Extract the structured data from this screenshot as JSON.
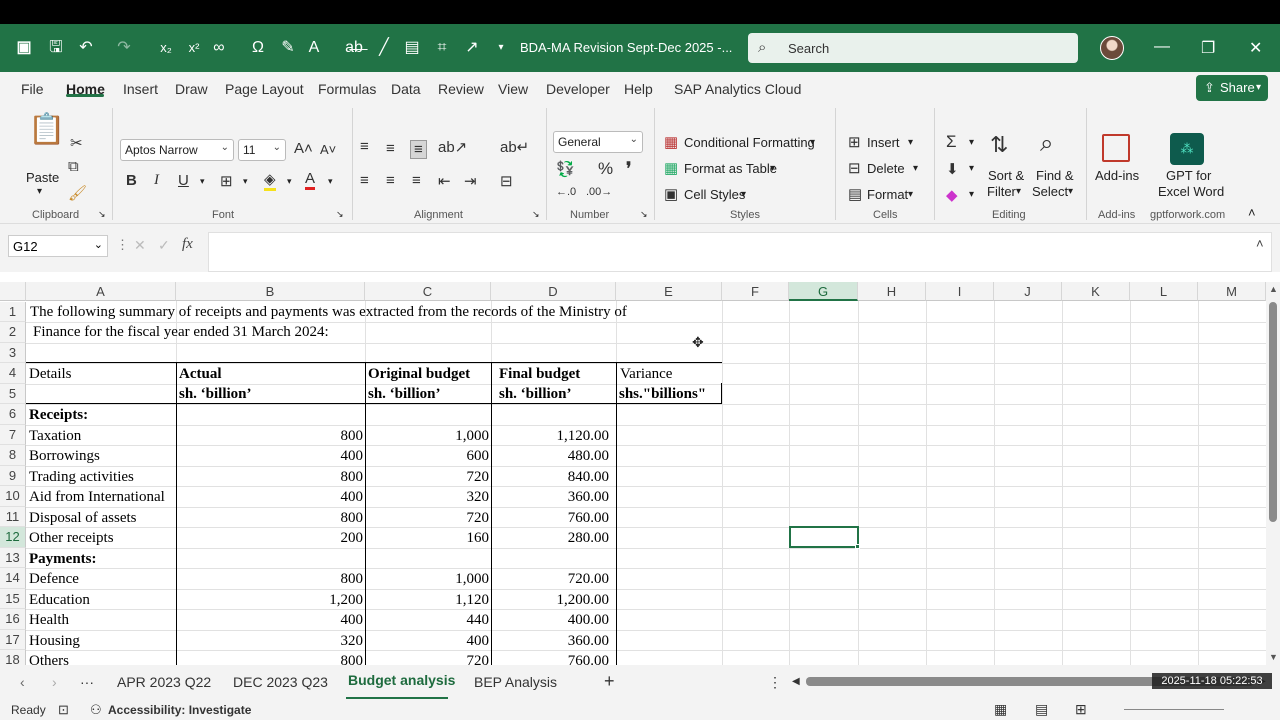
{
  "title_bar": {
    "doc_title": "BDA-MA Revision Sept-Dec 2025  -...",
    "search_placeholder": "Search"
  },
  "menu": {
    "tabs": [
      "File",
      "Home",
      "Insert",
      "Draw",
      "Page Layout",
      "Formulas",
      "Data",
      "Review",
      "View",
      "Developer",
      "Help",
      "SAP Analytics Cloud"
    ],
    "active": "Home",
    "share_label": "Share"
  },
  "ribbon": {
    "clipboard": {
      "paste": "Paste",
      "label": "Clipboard"
    },
    "font": {
      "name": "Aptos Narrow",
      "size": "11",
      "label": "Font"
    },
    "alignment": {
      "label": "Alignment"
    },
    "number": {
      "format": "General",
      "label": "Number"
    },
    "styles": {
      "conditional": "Conditional Formatting",
      "format_table": "Format as Table",
      "cell_styles": "Cell Styles",
      "label": "Styles"
    },
    "cells": {
      "insert": "Insert",
      "delete": "Delete",
      "format": "Format",
      "label": "Cells"
    },
    "editing": {
      "sort1": "Sort &",
      "sort2": "Filter",
      "find1": "Find &",
      "find2": "Select",
      "label": "Editing"
    },
    "addins": {
      "btn": "Add-ins",
      "label": "Add-ins"
    },
    "gpt": {
      "line1": "GPT for",
      "line2": "Excel Word",
      "label": "gptforwork.com"
    }
  },
  "formula_bar": {
    "name_box": "G12",
    "fx": "fx",
    "content": ""
  },
  "sheet": {
    "columns": [
      "A",
      "B",
      "C",
      "D",
      "E",
      "F",
      "G",
      "H",
      "I",
      "J",
      "K",
      "L",
      "M"
    ],
    "selected_column": "G",
    "selected_row": "12",
    "rows": [
      "1",
      "2",
      "3",
      "4",
      "5",
      "6",
      "7",
      "8",
      "9",
      "10",
      "11",
      "12",
      "13",
      "14",
      "15",
      "16",
      "17",
      "18"
    ],
    "r1": "The following summary of receipts and payments was extracted from the records of the Ministry of",
    "r2": "Finance for the fiscal year ended 31 March 2024:",
    "header": {
      "details": "Details",
      "actual": "Actual",
      "actual_unit": "sh. ‘billion’",
      "original": "Original budget",
      "original_unit": "sh. ‘billion’",
      "final": "Final budget",
      "final_unit": "sh. ‘billion’",
      "variance": "Variance",
      "variance_unit": "shs.\"billions\""
    },
    "receipts_label": "Receipts:",
    "payments_label": "Payments:",
    "receipts": [
      {
        "name": "Taxation",
        "actual": "800",
        "original": "1,000",
        "final": "1,120.00"
      },
      {
        "name": "Borrowings",
        "actual": "400",
        "original": "600",
        "final": "480.00"
      },
      {
        "name": "Trading activities",
        "actual": "800",
        "original": "720",
        "final": "840.00"
      },
      {
        "name": "Aid from International",
        "actual": "400",
        "original": "320",
        "final": "360.00"
      },
      {
        "name": "Disposal of assets",
        "actual": "800",
        "original": "720",
        "final": "760.00"
      },
      {
        "name": "Other receipts",
        "actual": "200",
        "original": "160",
        "final": "280.00"
      }
    ],
    "payments": [
      {
        "name": "Defence",
        "actual": "800",
        "original": "1,000",
        "final": "720.00"
      },
      {
        "name": "Education",
        "actual": "1,200",
        "original": "1,120",
        "final": "1,200.00"
      },
      {
        "name": "Health",
        "actual": "400",
        "original": "440",
        "final": "400.00"
      },
      {
        "name": "Housing",
        "actual": "320",
        "original": "400",
        "final": "360.00"
      },
      {
        "name": "Others",
        "actual": "800",
        "original": "720",
        "final": "760.00"
      }
    ]
  },
  "sheet_tabs": {
    "tabs": [
      "APR 2023 Q22",
      "DEC 2023 Q23",
      "Budget analysis",
      "BEP Analysis"
    ],
    "active": "Budget analysis"
  },
  "status": {
    "ready": "Ready",
    "accessibility": "Accessibility: Investigate",
    "timestamp": "2025-11-18  05:22:53"
  },
  "colors": {
    "accent": "#217346",
    "selection_header": "#d3e7db"
  }
}
